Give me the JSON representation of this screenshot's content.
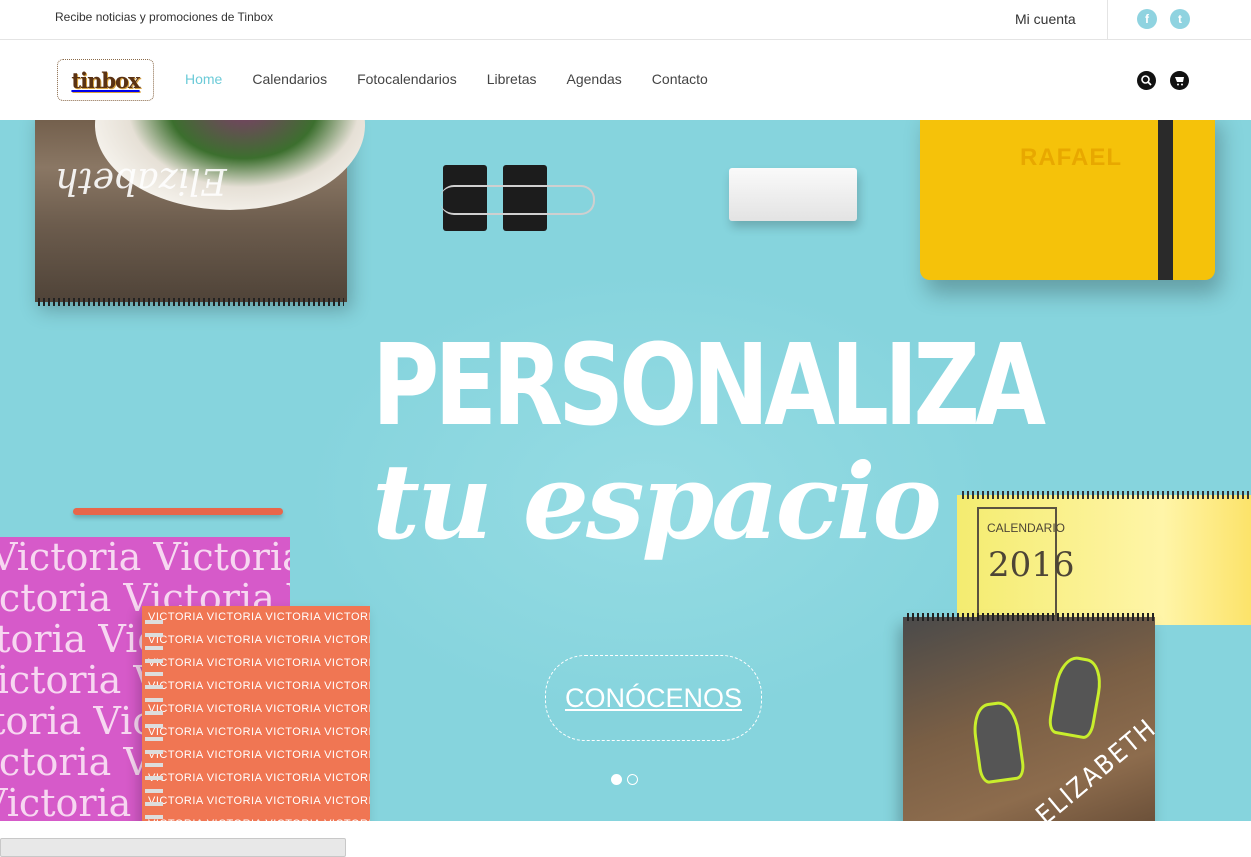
{
  "topbar": {
    "promo_text": "Recibe noticias y promociones de Tinbox",
    "account_label": "Mi cuenta",
    "social": [
      {
        "icon": "facebook-icon",
        "glyph": "f"
      },
      {
        "icon": "twitter-icon",
        "glyph": "t"
      }
    ]
  },
  "header": {
    "logo_text": "tinbox",
    "nav": [
      "Home",
      "Calendarios",
      "Fotocalendarios",
      "Libretas",
      "Agendas",
      "Contacto"
    ],
    "active_nav": "Home",
    "icons": [
      "search-icon",
      "cart-icon"
    ]
  },
  "hero": {
    "headline": "PERSONALIZA",
    "subline": "tu espacio",
    "cta_label": "CONÓCENOS",
    "slides_total": 2,
    "slide_active": 1,
    "props": {
      "top_calendar_name": "Elizabeth",
      "notebook_name": "RAFAEL",
      "pink_notebook_text": "Victoria Victoria Victoria",
      "orange_notebook_text": "VICTORIA VICTORIA VICTORIA VICTORIA",
      "calendar_label": "CALENDARIO",
      "calendar_year": "2016",
      "shoes_calendar_name": "ELIZABETH"
    }
  },
  "colors": {
    "accent": "#6ccbd8",
    "hero_bg": "#86d4dd",
    "social_bg": "#8fd3e0"
  }
}
